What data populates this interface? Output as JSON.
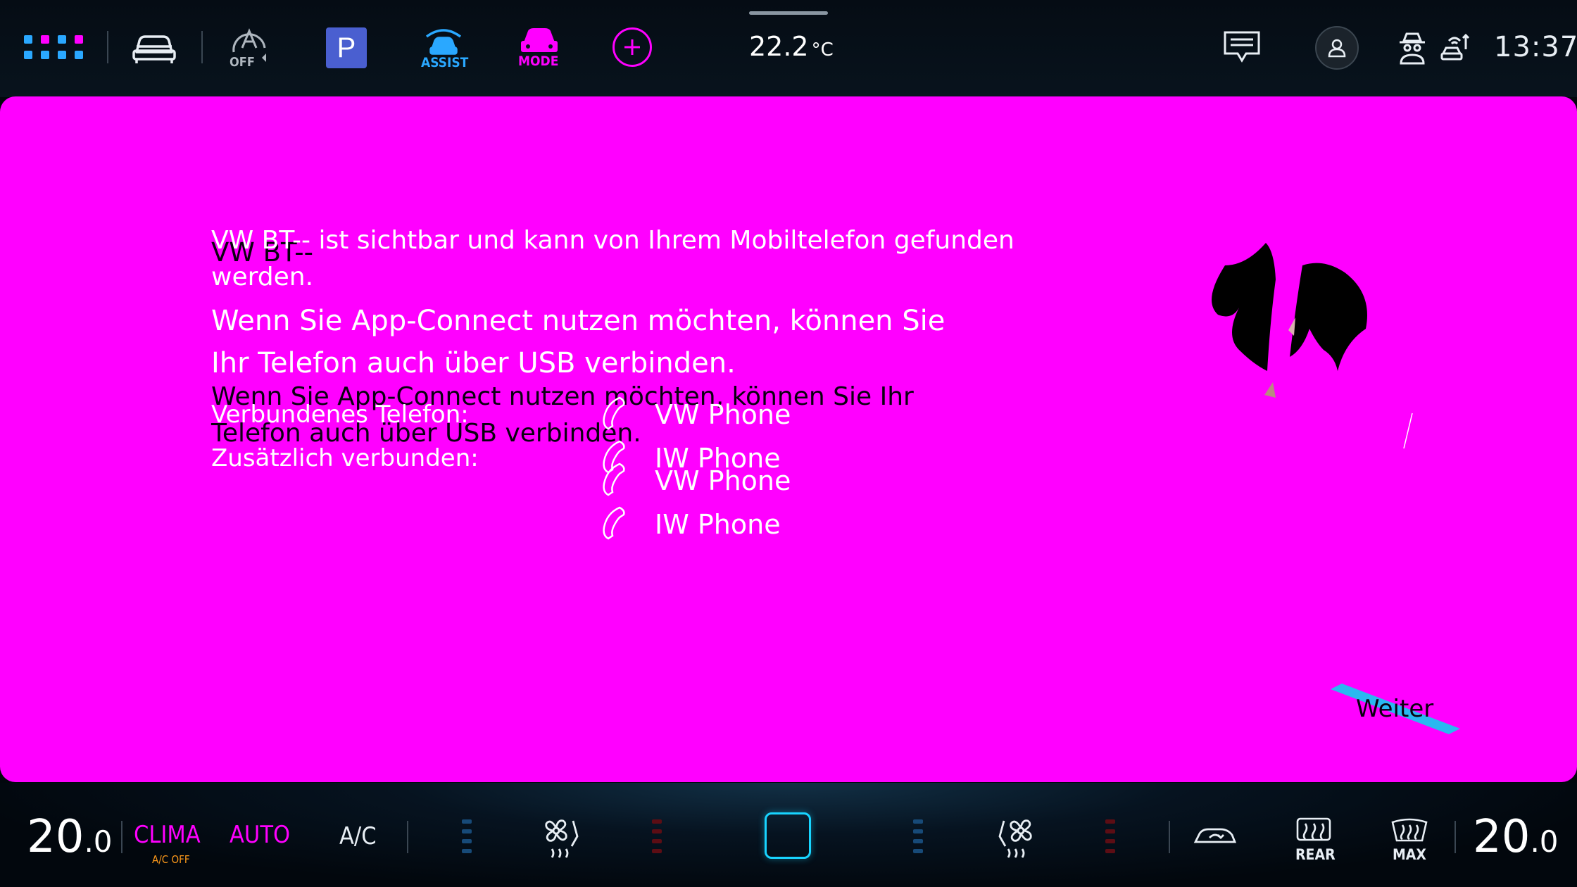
{
  "top_bar": {
    "assist_off_label": "OFF",
    "park_label": "P",
    "assist_label": "ASSIST",
    "mode_label": "MODE",
    "outside_temp_value": "22.2",
    "outside_temp_unit": "°C",
    "clock": "13:37",
    "colors": {
      "accent_magenta": "#ff00ff",
      "accent_blue": "#2aa8ff",
      "park_bg": "#4a5fd0"
    }
  },
  "main": {
    "device_name": "VW BT--",
    "visibility_text_line1": "VW BT-- ist sichtbar und kann von Ihrem Mobiltelefon gefunden",
    "visibility_text_line2": "werden.",
    "usb_hint_line1": "Wenn Sie App-Connect nutzen möchten, können Sie",
    "usb_hint_line2": "Ihr Telefon auch über USB verbinden.",
    "usb_hint_dark_line1": "Wenn Sie App-Connect nutzen möchten, können Sie Ihr",
    "usb_hint_dark_line2": "Telefon auch über USB verbinden.",
    "connected_phone_label": "Verbundenes Telefon:",
    "additional_connected_label": "Zusätzlich verbunden:",
    "phones": [
      "VW Phone",
      "IW Phone",
      "VW Phone",
      "IW Phone"
    ],
    "next_button": "Weiter"
  },
  "bottom_bar": {
    "left_temp_int": "20",
    "left_temp_dec": ".0",
    "clima_label": "CLIMA",
    "ac_off_label": "A/C OFF",
    "auto_label": "AUTO",
    "ac_label": "A/C",
    "rear_label": "REAR",
    "max_label": "MAX",
    "right_temp_int": "20",
    "right_temp_dec": ".0"
  }
}
